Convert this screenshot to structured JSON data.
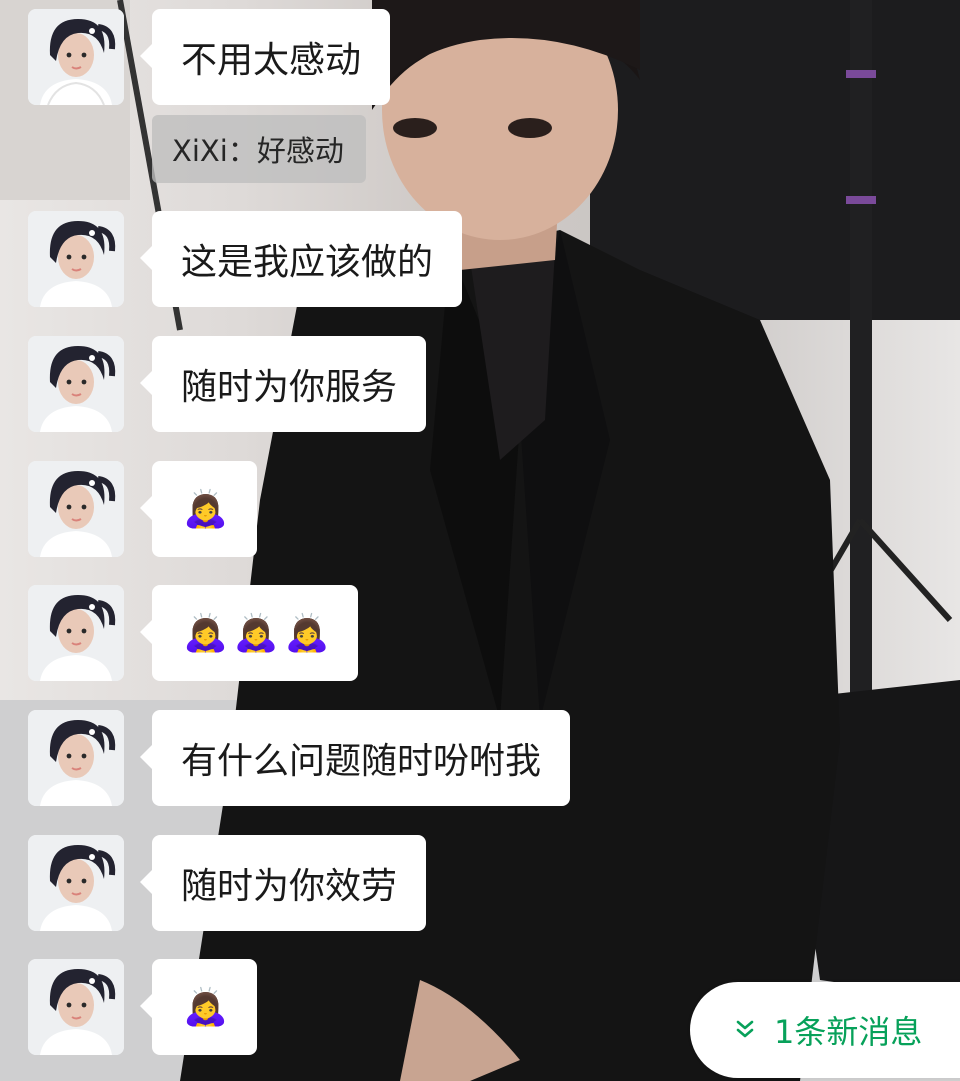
{
  "messages": [
    {
      "type": "text",
      "text": "不用太感动"
    },
    {
      "type": "text",
      "text": "这是我应该做的"
    },
    {
      "type": "text",
      "text": "随时为你服务"
    },
    {
      "type": "emoji",
      "emoji": [
        "🙇‍♀️"
      ]
    },
    {
      "type": "emoji",
      "emoji": [
        "🙇‍♀️",
        "🙇‍♀️",
        "🙇‍♀️"
      ]
    },
    {
      "type": "text",
      "text": "有什么问题随时吩咐我"
    },
    {
      "type": "text",
      "text": "随时为你效劳"
    },
    {
      "type": "emoji",
      "emoji": [
        "🙇‍♀️"
      ]
    }
  ],
  "quote": {
    "text": "XiXi：好感动"
  },
  "new_message_pill": {
    "label": "1条新消息",
    "icon": "double-chevron-down-icon",
    "color": "#07a15a"
  },
  "colors": {
    "bubble": "#ffffff",
    "text": "#1a1a1a"
  }
}
